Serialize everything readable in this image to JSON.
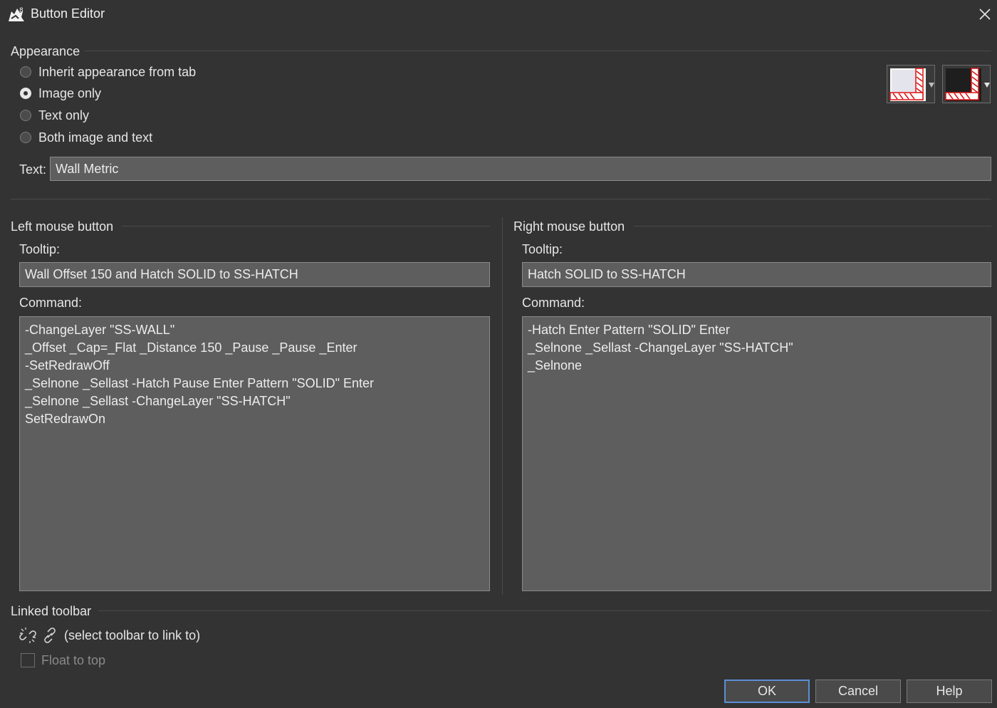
{
  "window": {
    "title": "Button Editor"
  },
  "appearance": {
    "label": "Appearance",
    "options": [
      {
        "label": "Inherit appearance from tab",
        "checked": false
      },
      {
        "label": "Image only",
        "checked": true
      },
      {
        "label": "Text only",
        "checked": false
      },
      {
        "label": "Both image and text",
        "checked": false
      }
    ],
    "text_label": "Text:",
    "text_value": "Wall Metric",
    "image_buttons": [
      "light-image-icon",
      "dark-image-icon"
    ]
  },
  "left_mouse": {
    "label": "Left mouse button",
    "tooltip_label": "Tooltip:",
    "tooltip_value": "Wall Offset 150 and Hatch SOLID to SS-HATCH",
    "command_label": "Command:",
    "command_value": "-ChangeLayer \"SS-WALL\"\n_Offset _Cap=_Flat _Distance 150 _Pause _Pause _Enter\n-SetRedrawOff\n_Selnone _Sellast -Hatch Pause Enter Pattern \"SOLID\" Enter\n_Selnone _Sellast -ChangeLayer \"SS-HATCH\"\nSetRedrawOn"
  },
  "right_mouse": {
    "label": "Right mouse button",
    "tooltip_label": "Tooltip:",
    "tooltip_value": "Hatch SOLID to SS-HATCH",
    "command_label": "Command:",
    "command_value": "-Hatch Enter Pattern \"SOLID\" Enter\n_Selnone _Sellast -ChangeLayer \"SS-HATCH\"\n_Selnone"
  },
  "linked_toolbar": {
    "label": "Linked toolbar",
    "link_text": "(select toolbar to link to)",
    "float_label": "Float to top"
  },
  "footer": {
    "ok": "OK",
    "cancel": "Cancel",
    "help": "Help"
  }
}
